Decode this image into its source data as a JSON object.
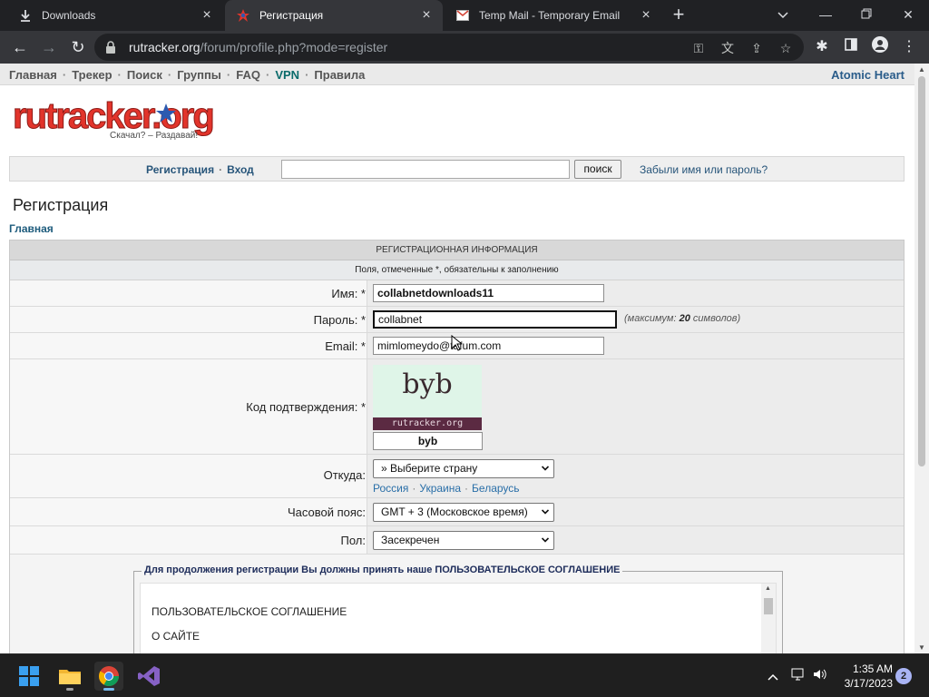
{
  "browser": {
    "tabs": [
      {
        "title": "Downloads",
        "icon": "download-icon",
        "active": false
      },
      {
        "title": "Регистрация",
        "icon": "rutracker-icon",
        "active": true
      },
      {
        "title": "Temp Mail - Temporary Email",
        "icon": "mail-icon",
        "active": false
      }
    ],
    "url_host": "rutracker.org",
    "url_path": "/forum/profile.php?mode=register"
  },
  "site": {
    "nav": [
      "Главная",
      "Трекер",
      "Поиск",
      "Группы",
      "FAQ",
      "VPN",
      "Правила"
    ],
    "promo": "Atomic Heart",
    "logo_text": "rutracker.org",
    "slogan": "Скачал? – Раздавай!",
    "login": {
      "register": "Регистрация",
      "login": "Вход",
      "search_value": "",
      "search_button": "поиск",
      "forgot": "Забыли имя или пароль?"
    },
    "title": "Регистрация",
    "breadcrumb": "Главная"
  },
  "form": {
    "header": "Регистрационная информация",
    "required_note": "Поля, отмеченные *, обязательны к заполнению",
    "username_label": "Имя: *",
    "username_value": "collabnetdownloads11",
    "password_label": "Пароль: *",
    "password_value": "collabnet",
    "password_hint_prefix": "(максимум:",
    "password_hint_num": "20",
    "password_hint_suffix": "символов)",
    "email_label": "Email: *",
    "email_value": "mimlomeydo@tafum.com",
    "captcha_label": "Код подтверждения: *",
    "captcha_word": "byb",
    "captcha_footer": "rutracker.org",
    "captcha_value": "byb",
    "from_label": "Откуда:",
    "from_value": "» Выберите страну",
    "countries": [
      "Россия",
      "Украина",
      "Беларусь"
    ],
    "timezone_label": "Часовой пояс:",
    "timezone_value": "GMT + 3 (Московское время)",
    "gender_label": "Пол:",
    "gender_value": "Засекречен",
    "agreement_legend": "Для продолжения регистрации Вы должны принять наше ПОЛЬЗОВАТЕЛЬСКОЕ СОГЛАШЕНИЕ",
    "agreement_line1": "ПОЛЬЗОВАТЕЛЬСКОЕ СОГЛАШЕНИЕ",
    "agreement_line2": "О САЙТЕ"
  },
  "taskbar": {
    "time": "1:35 AM",
    "date": "3/17/2023",
    "notifications": "2",
    "apps": [
      "start-icon",
      "file-explorer-icon",
      "chrome-icon",
      "visual-studio-icon"
    ]
  }
}
